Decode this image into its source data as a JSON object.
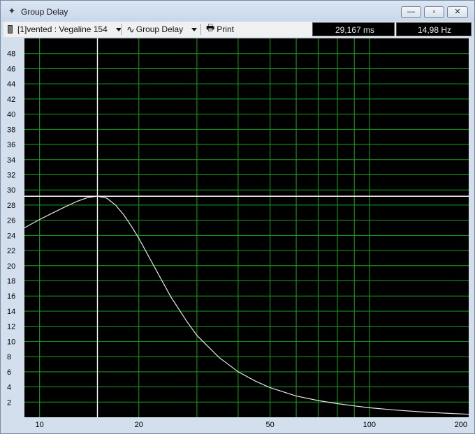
{
  "window": {
    "title": "Group Delay"
  },
  "titlebar_buttons": {
    "minimize": "—",
    "maximize": "▫",
    "close": "✕"
  },
  "toolbar": {
    "source_label": "[1]vented : Vegaline 154",
    "view_label": "Group Delay",
    "print_label": "Print",
    "delay_readout": "29,167 ms",
    "freq_readout": "14,98 Hz"
  },
  "colors": {
    "plot_bg": "#000000",
    "grid": "#17a31a",
    "curve": "#e8e8e8",
    "cursor": "#ffffff"
  },
  "chart_data": {
    "type": "line",
    "title": "",
    "xlabel": "",
    "ylabel": "",
    "xscale": "log",
    "xlim": [
      9,
      200
    ],
    "ylim": [
      0,
      50
    ],
    "x_tick_labels": [
      "10",
      "20",
      "50",
      "100",
      "200"
    ],
    "y_tick_labels": [
      "2",
      "4",
      "6",
      "8",
      "10",
      "12",
      "14",
      "16",
      "18",
      "20",
      "22",
      "24",
      "26",
      "28",
      "30",
      "32",
      "34",
      "36",
      "38",
      "40",
      "42",
      "44",
      "46",
      "48"
    ],
    "grid": true,
    "cursor": {
      "x": 14.98,
      "y": 29.167
    },
    "series": [
      {
        "x": [
          9,
          10,
          11,
          12,
          13,
          14,
          14.98,
          16,
          17,
          18,
          19,
          20,
          22,
          25,
          28,
          30,
          35,
          40,
          45,
          50,
          60,
          70,
          80,
          90,
          100,
          120,
          150,
          200
        ],
        "values": [
          25.0,
          26.1,
          27.0,
          27.8,
          28.5,
          29.0,
          29.167,
          28.9,
          28.0,
          26.7,
          25.2,
          23.6,
          20.3,
          15.9,
          12.6,
          10.8,
          7.9,
          6.0,
          4.8,
          3.9,
          2.8,
          2.2,
          1.8,
          1.5,
          1.25,
          0.95,
          0.65,
          0.4
        ]
      }
    ]
  }
}
